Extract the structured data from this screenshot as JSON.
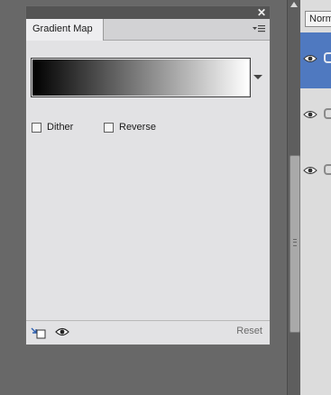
{
  "panel": {
    "tab_label": "Gradient Map",
    "close_glyph": "✕",
    "gradient": {
      "start_color": "#000000",
      "end_color": "#ffffff"
    },
    "options": [
      {
        "label": "Dither",
        "checked": false
      },
      {
        "label": "Reverse",
        "checked": false
      }
    ],
    "footer": {
      "clip_icon": "clip-to-layer-icon",
      "visibility_icon": "eye-icon",
      "reset_label": "Reset"
    }
  },
  "layers_panel": {
    "blend_mode": "Norm",
    "rows": [
      {
        "selected": true,
        "icon": "eye-icon"
      },
      {
        "selected": false,
        "icon": "eye-icon"
      },
      {
        "selected": false,
        "icon": "eye-icon"
      }
    ]
  }
}
